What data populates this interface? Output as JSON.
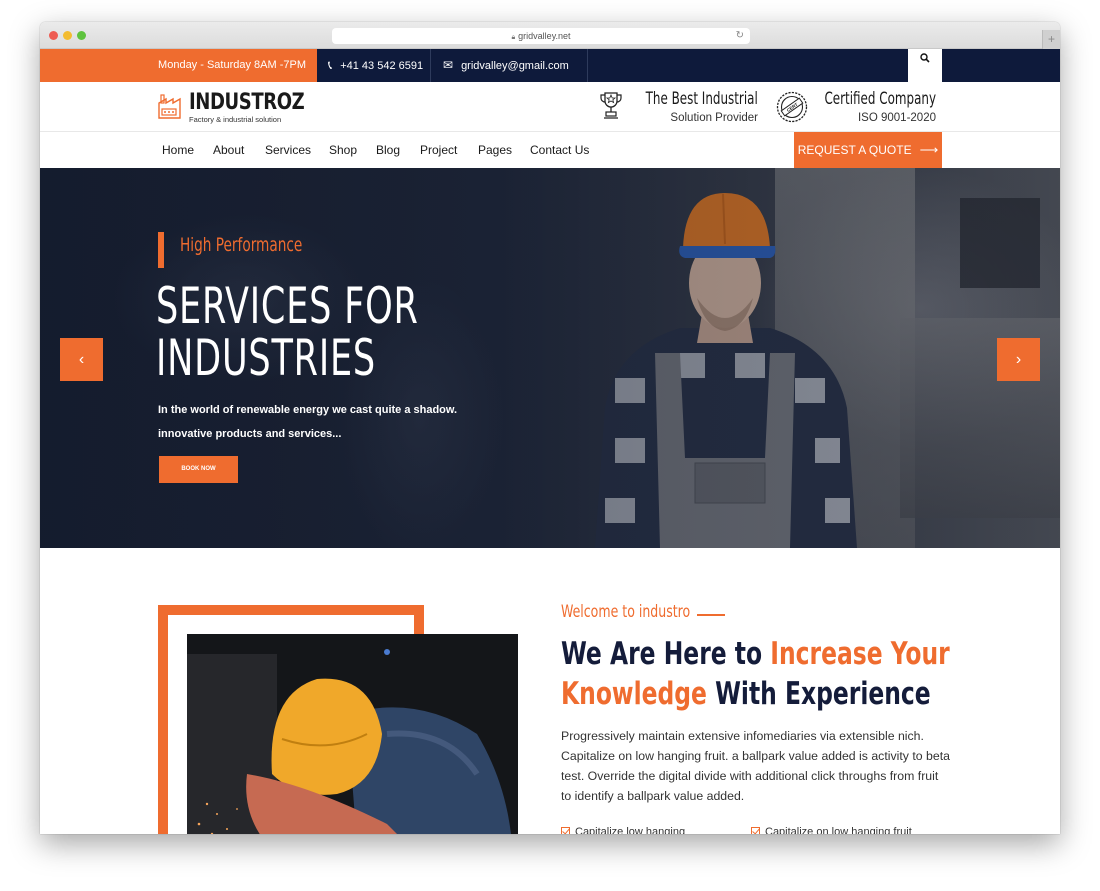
{
  "browser": {
    "url": "gridvalley.net"
  },
  "topbar": {
    "hours": "Monday - Saturday 8AM -7PM",
    "phone": "+41 43 542 6591",
    "email": "gridvalley@gmail.com"
  },
  "header": {
    "brand": "INDUSTROZ",
    "tagline": "Factory & industrial solution",
    "badges": [
      {
        "title": "The Best Industrial",
        "subtitle": "Solution Provider",
        "icon": "trophy-icon"
      },
      {
        "title": "Certified Company",
        "subtitle": "ISO 9001-2020",
        "icon": "certified-seal-icon"
      }
    ]
  },
  "nav": {
    "items": [
      {
        "label": "Home"
      },
      {
        "label": "About"
      },
      {
        "label": "Services"
      },
      {
        "label": "Shop"
      },
      {
        "label": "Blog"
      },
      {
        "label": "Project"
      },
      {
        "label": "Pages"
      },
      {
        "label": "Contact Us"
      }
    ],
    "cta": "REQUEST A QUOTE",
    "cta_arrow": "⟶"
  },
  "hero": {
    "kicker": "High Performance",
    "title_line1": "SERVICES FOR",
    "title_line2": "INDUSTRIES",
    "desc_line1": "In the world of renewable energy we cast quite a shadow.",
    "desc_line2": "innovative products and services...",
    "button": "BOOK NOW",
    "prev": "‹",
    "next": "›"
  },
  "about": {
    "kicker": "Welcome to industro",
    "title_part1": "We Are Here to ",
    "title_hl1": "Increase Your",
    "title_hl2": "Knowledge",
    "title_part2": " With Experience",
    "description": "Progressively maintain extensive infomediaries via extensible nich. Capitalize on low hanging fruit. a ballpark value added is activity to beta test. Override the digital divide with additional click throughs from fruit to identify a ballpark value added.",
    "checks": [
      {
        "label": "Capitalize low hanging"
      },
      {
        "label": "Capitalize on low hanging fruit"
      }
    ]
  },
  "colors": {
    "accent": "#ef6c2f",
    "navy": "#0e1a3b",
    "heading": "#141c3a"
  }
}
